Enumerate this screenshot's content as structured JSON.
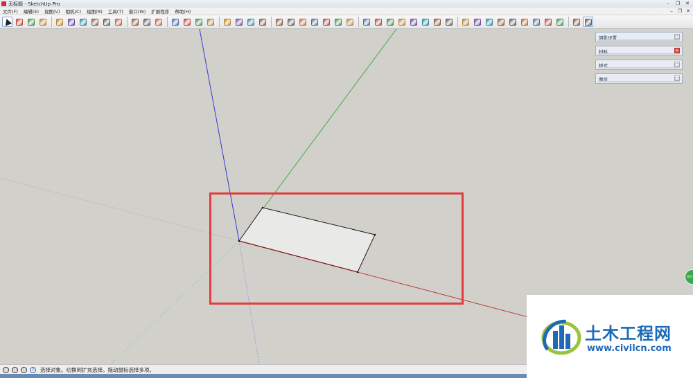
{
  "window": {
    "title": "无标题 - SketchUp Pro",
    "controls": [
      "–",
      "❐",
      "✕"
    ]
  },
  "menubar": {
    "items": [
      "文件(F)",
      "编辑(E)",
      "视图(V)",
      "相机(C)",
      "绘图(R)",
      "工具(T)",
      "窗口(W)",
      "扩展程序",
      "帮助(H)"
    ],
    "controls": [
      "–",
      "❐",
      "✕"
    ]
  },
  "toolbar": {
    "groups": [
      [
        "select-tool",
        "eraser-tool",
        "line-tool",
        "arc-tool"
      ],
      [
        "rectangle-tool",
        "push-pull-tool",
        "follow-me-tool",
        "move-tool",
        "rotate-tool",
        "scale-tool"
      ],
      [
        "tape-measure-tool",
        "text-tool",
        "paint-bucket-tool"
      ],
      [
        "orbit-tool",
        "pan-tool",
        "zoom-tool",
        "zoom-extents-tool"
      ],
      [
        "warehouse-icon",
        "extension-warehouse-icon",
        "layout-icon",
        "send-to-layout-icon"
      ],
      [
        "sandbox-smoove-icon",
        "sandbox-stamp-icon",
        "sandbox-drape-icon",
        "sandbox-grid-icon",
        "sandbox-contours-icon",
        "sandbox-detail-icon",
        "sandbox-flip-icon"
      ],
      [
        "solid-union-icon",
        "solid-subtract-icon",
        "solid-trim-icon",
        "solid-intersect-icon",
        "solid-split-icon",
        "solid-shell-icon",
        "solid-outer-icon",
        "solid-inspector-icon"
      ],
      [
        "section-plane-icon",
        "section-display-icon",
        "section-cut-icon",
        "section-fill-icon",
        "shadow-icon",
        "fog-icon",
        "style-icon",
        "edge-style-icon",
        "face-style-icon"
      ],
      [
        "ruby-console-icon",
        "su-logo-icon"
      ]
    ]
  },
  "trays": [
    {
      "title": "阴影设置",
      "button": "▢"
    },
    {
      "title": "材料",
      "button": "✕"
    },
    {
      "title": "样式",
      "button": "▢"
    },
    {
      "title": "图层",
      "button": "▢"
    }
  ],
  "statusbar": {
    "icons": [
      "ⓘ",
      "ⓘ",
      "ⓘ",
      "?"
    ],
    "text": "选择对象。切换到扩充选择。拖动鼠标选择多项。"
  },
  "side_widget": {
    "label": "GO"
  },
  "watermark": {
    "name": "土木工程网",
    "url": "www.civilcn.com"
  },
  "colors": {
    "viewport_bg": "#d1d0cb",
    "axis_red": "#c04040",
    "axis_green": "#4aa84a",
    "axis_blue": "#3a3ad0",
    "highlight": "#e23c3c",
    "face": "#e9e9e7",
    "brand_blue": "#1e6ab8"
  }
}
